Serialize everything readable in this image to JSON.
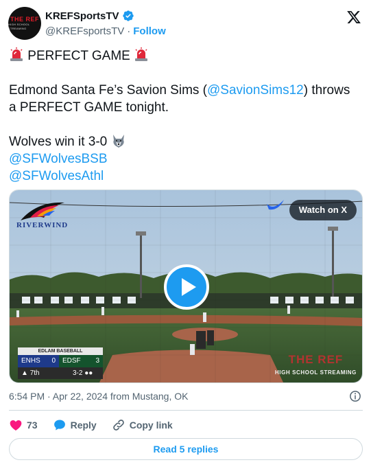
{
  "account": {
    "display_name": "KREFSportsTV",
    "handle": "@KREFsportsTV",
    "separator": "·",
    "follow_label": "Follow",
    "avatar_top": "THE REF",
    "avatar_bottom": "HIGH SCHOOL STREAMING",
    "verified": true
  },
  "tweet": {
    "line1": "PERFECT GAME",
    "line2_pre": "Edmond Santa Fe’s Savion Sims (",
    "line2_mention": "@SavionSims12",
    "line2_post": ") throws",
    "line3": "a PERFECT GAME tonight.",
    "line4": "Wolves win it 3-0",
    "mention2": "@SFWolvesBSB",
    "mention3": "@SFWolvesAthl",
    "emoji_siren": "siren-icon",
    "emoji_wolf": "wolf-icon"
  },
  "media": {
    "watch_label": "Watch on X",
    "sponsor": "RIVERWIND",
    "scorebug": {
      "title": "EDLAM BASEBALL",
      "team1": "ENHS",
      "score1": "0",
      "team2": "EDSF",
      "score2": "3",
      "inning": "7th",
      "inning_arrow": "▲",
      "count": "3-2",
      "outs": "●●"
    },
    "overlay_big": "THE REF",
    "overlay_small": "HIGH SCHOOL STREAMING"
  },
  "meta": {
    "timestamp": "6:54 PM · Apr 22, 2024 from Mustang, OK"
  },
  "actions": {
    "likes": "73",
    "reply_label": "Reply",
    "copy_label": "Copy link"
  },
  "footer": {
    "read_replies": "Read 5 replies"
  },
  "colors": {
    "accent": "#1d9bf0",
    "like": "#f91880",
    "text": "#0f1419",
    "muted": "#536471"
  }
}
